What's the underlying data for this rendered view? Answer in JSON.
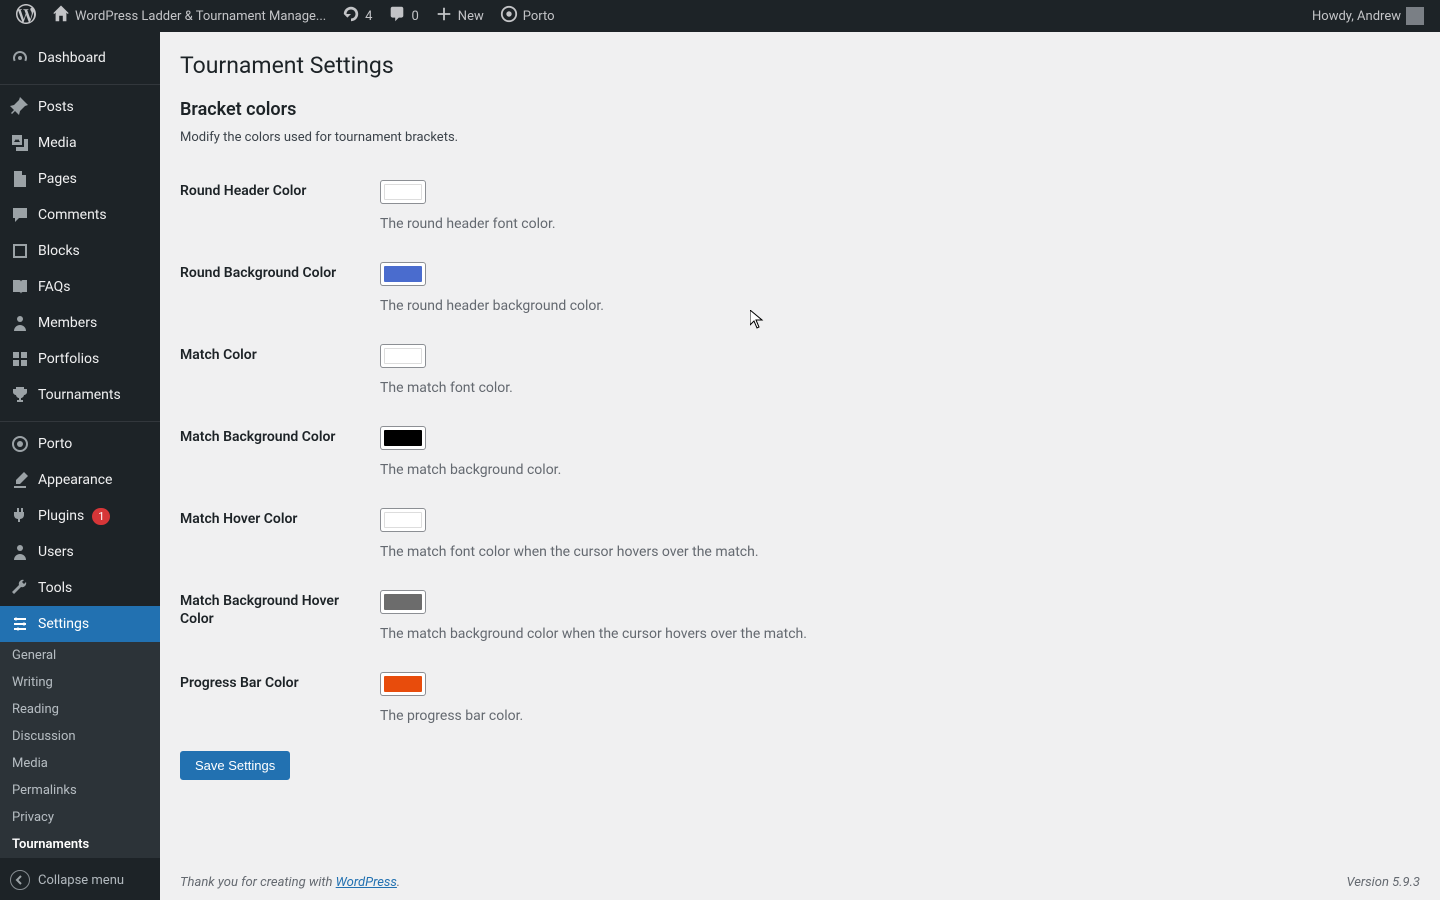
{
  "adminbar": {
    "site_title": "WordPress Ladder & Tournament Manage...",
    "refresh_count": "4",
    "comments_count": "0",
    "new_label": "New",
    "porto_label": "Porto",
    "greeting": "Howdy, Andrew"
  },
  "sidebar": {
    "items": [
      {
        "label": "Dashboard"
      },
      {
        "label": "Posts"
      },
      {
        "label": "Media"
      },
      {
        "label": "Pages"
      },
      {
        "label": "Comments"
      },
      {
        "label": "Blocks"
      },
      {
        "label": "FAQs"
      },
      {
        "label": "Members"
      },
      {
        "label": "Portfolios"
      },
      {
        "label": "Tournaments"
      },
      {
        "label": "Porto"
      },
      {
        "label": "Appearance"
      },
      {
        "label": "Plugins",
        "badge": "1"
      },
      {
        "label": "Users"
      },
      {
        "label": "Tools"
      },
      {
        "label": "Settings"
      }
    ],
    "submenu": [
      {
        "label": "General"
      },
      {
        "label": "Writing"
      },
      {
        "label": "Reading"
      },
      {
        "label": "Discussion"
      },
      {
        "label": "Media"
      },
      {
        "label": "Permalinks"
      },
      {
        "label": "Privacy"
      },
      {
        "label": "Tournaments"
      }
    ],
    "collapse_label": "Collapse menu"
  },
  "page": {
    "title": "Tournament Settings",
    "section_title": "Bracket colors",
    "section_desc": "Modify the colors used for tournament brackets.",
    "fields": [
      {
        "label": "Round Header Color",
        "color": "#ffffff",
        "help": "The round header font color."
      },
      {
        "label": "Round Background Color",
        "color": "#4a6cce",
        "help": "The round header background color."
      },
      {
        "label": "Match Color",
        "color": "#ffffff",
        "help": "The match font color."
      },
      {
        "label": "Match Background Color",
        "color": "#000000",
        "help": "The match background color."
      },
      {
        "label": "Match Hover Color",
        "color": "#ffffff",
        "help": "The match font color when the cursor hovers over the match."
      },
      {
        "label": "Match Background Hover Color",
        "color": "#6c6c6c",
        "help": "The match background color when the cursor hovers over the match."
      },
      {
        "label": "Progress Bar Color",
        "color": "#e84c0c",
        "help": "The progress bar color."
      }
    ],
    "save_label": "Save Settings"
  },
  "footer": {
    "thanks_prefix": "Thank you for creating with ",
    "wordpress": "WordPress",
    "version": "Version 5.9.3"
  }
}
